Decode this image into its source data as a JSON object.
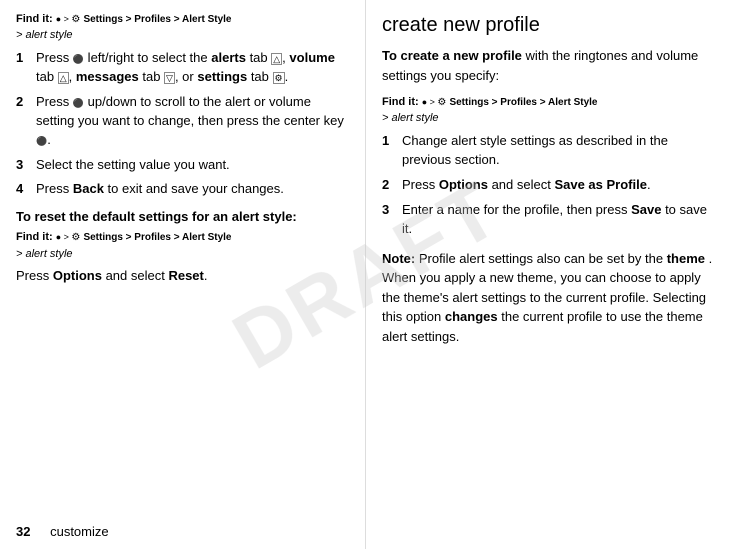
{
  "left": {
    "find_it_label": "Find it:",
    "nav_path": "Settings > Profiles > Alert Style",
    "alert_style_suffix": "> alert style",
    "steps": [
      {
        "number": "1",
        "text_parts": [
          {
            "text": "Press ",
            "bold": false
          },
          {
            "text": "S",
            "bold": false,
            "icon": true
          },
          {
            "text": " left/right to select the ",
            "bold": false
          },
          {
            "text": "alerts",
            "bold": true
          },
          {
            "text": " tab ",
            "bold": false
          },
          {
            "text": "a",
            "bold": false,
            "icon": true
          },
          {
            "text": ", ",
            "bold": false
          },
          {
            "text": "volume",
            "bold": true
          },
          {
            "text": " tab ",
            "bold": false
          },
          {
            "text": "b",
            "bold": false,
            "icon": true
          },
          {
            "text": ", ",
            "bold": false
          },
          {
            "text": "messages",
            "bold": true
          },
          {
            "text": " tab ",
            "bold": false
          },
          {
            "text": "c",
            "bold": false,
            "icon": true
          },
          {
            "text": ", or ",
            "bold": false
          },
          {
            "text": "settings",
            "bold": true
          },
          {
            "text": " tab ",
            "bold": false
          },
          {
            "text": "d",
            "bold": false,
            "icon": true
          },
          {
            "text": ".",
            "bold": false
          }
        ]
      },
      {
        "number": "2",
        "text": "Press S up/down to scroll to the alert or volume setting you want to change, then press the center key S."
      },
      {
        "number": "3",
        "text": "Select the setting value you want."
      },
      {
        "number": "4",
        "text_parts": [
          {
            "text": "Press ",
            "bold": false
          },
          {
            "text": "Back",
            "bold": true,
            "code": true
          },
          {
            "text": " to exit and save your changes.",
            "bold": false
          }
        ]
      }
    ],
    "reset_heading": "To reset the default settings for an alert style:",
    "find_it2_label": "Find it:",
    "nav_path2": "Settings > Profiles > Alert Style",
    "alert_style_suffix2": "> alert style",
    "reset_instruction_parts": [
      {
        "text": "Press ",
        "bold": false
      },
      {
        "text": "Options",
        "bold": false,
        "code": true
      },
      {
        "text": " and select ",
        "bold": false
      },
      {
        "text": "Reset",
        "bold": false,
        "code": true
      },
      {
        "text": ".",
        "bold": false
      }
    ]
  },
  "right": {
    "section_title": "create new profile",
    "intro_parts": [
      {
        "text": "To create a new profile",
        "bold": true
      },
      {
        "text": " with the ringtones and volume settings you specify:",
        "bold": false
      }
    ],
    "find_it_label": "Find it:",
    "nav_path": "Settings > Profiles > Alert Style",
    "alert_style_suffix": "> alert style",
    "steps": [
      {
        "number": "1",
        "text": "Change alert style settings as described in the previous section."
      },
      {
        "number": "2",
        "text_parts": [
          {
            "text": "Press ",
            "bold": false
          },
          {
            "text": "Options",
            "bold": false,
            "code": true
          },
          {
            "text": " and select ",
            "bold": false
          },
          {
            "text": "Save as Profile",
            "bold": false,
            "code": true
          },
          {
            "text": ".",
            "bold": false
          }
        ]
      },
      {
        "number": "3",
        "text_parts": [
          {
            "text": "Enter a name for the profile, then press ",
            "bold": false
          },
          {
            "text": "Save",
            "bold": false,
            "code": true
          },
          {
            "text": " to save it.",
            "bold": false
          }
        ]
      }
    ],
    "note_label": "Note:",
    "note_text_parts": [
      {
        "text": " Profile alert settings also can be set by the ",
        "bold": false
      },
      {
        "text": "theme",
        "bold": true
      },
      {
        "text": ". When you apply a new theme, you can choose to apply the theme’s alert settings to the current profile. Selecting this option ",
        "bold": false
      },
      {
        "text": "changes",
        "bold": true
      },
      {
        "text": " the current profile to use the theme alert settings.",
        "bold": false
      }
    ]
  },
  "footer": {
    "page_number": "32",
    "page_label": "customize"
  },
  "icons": {
    "nav_dot": "●",
    "settings_icon": "⚙",
    "arrow": ">"
  }
}
